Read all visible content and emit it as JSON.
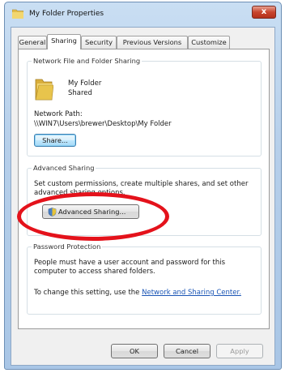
{
  "window": {
    "title": "My Folder Properties",
    "close_label": "x"
  },
  "tabs": [
    "General",
    "Sharing",
    "Security",
    "Previous Versions",
    "Customize"
  ],
  "network_sharing": {
    "group_label": "Network File and Folder Sharing",
    "folder_name": "My Folder",
    "folder_status": "Shared",
    "path_label": "Network Path:",
    "path_value": "\\\\WIN7\\Users\\brewer\\Desktop\\My Folder",
    "share_button": "Share..."
  },
  "advanced_sharing": {
    "group_label": "Advanced Sharing",
    "description_line1": "Set custom permissions, create multiple shares, and set other",
    "description_line2": "advanced sharing options.",
    "button_label": "Advanced Sharing..."
  },
  "password_protection": {
    "group_label": "Password Protection",
    "line1": "People must have a user account and password for this",
    "line2": "computer to access shared folders.",
    "change_prefix": "To change this setting, use the",
    "change_link": "Network and Sharing Center."
  },
  "footer": {
    "ok": "OK",
    "cancel": "Cancel",
    "apply": "Apply"
  },
  "colors": {
    "annotation": "#e4121b",
    "link": "#1a55b5",
    "folder": "#e8c44c"
  }
}
